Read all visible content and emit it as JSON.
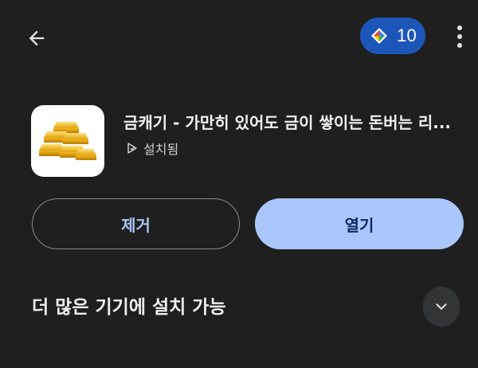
{
  "header": {
    "back_icon": "arrow-left-icon",
    "points_icon": "google-play-points-icon",
    "points_value": "10",
    "more_icon": "more-vert-icon"
  },
  "app": {
    "icon": "gold-bars-icon",
    "title": "금캐기 - 가만히 있어도 금이 쌓이는 돈버는 리...",
    "status_icon": "installed-play-icon",
    "status": "설치됨"
  },
  "actions": {
    "remove_label": "제거",
    "open_label": "열기"
  },
  "more_devices": {
    "label": "더 많은 기기에 설치 가능",
    "expand_icon": "chevron-down-icon"
  },
  "colors": {
    "background": "#1f1f1f",
    "points_pill": "#1d56b9",
    "open_button": "#a9c7fa",
    "remove_text": "#a9c4f3"
  }
}
